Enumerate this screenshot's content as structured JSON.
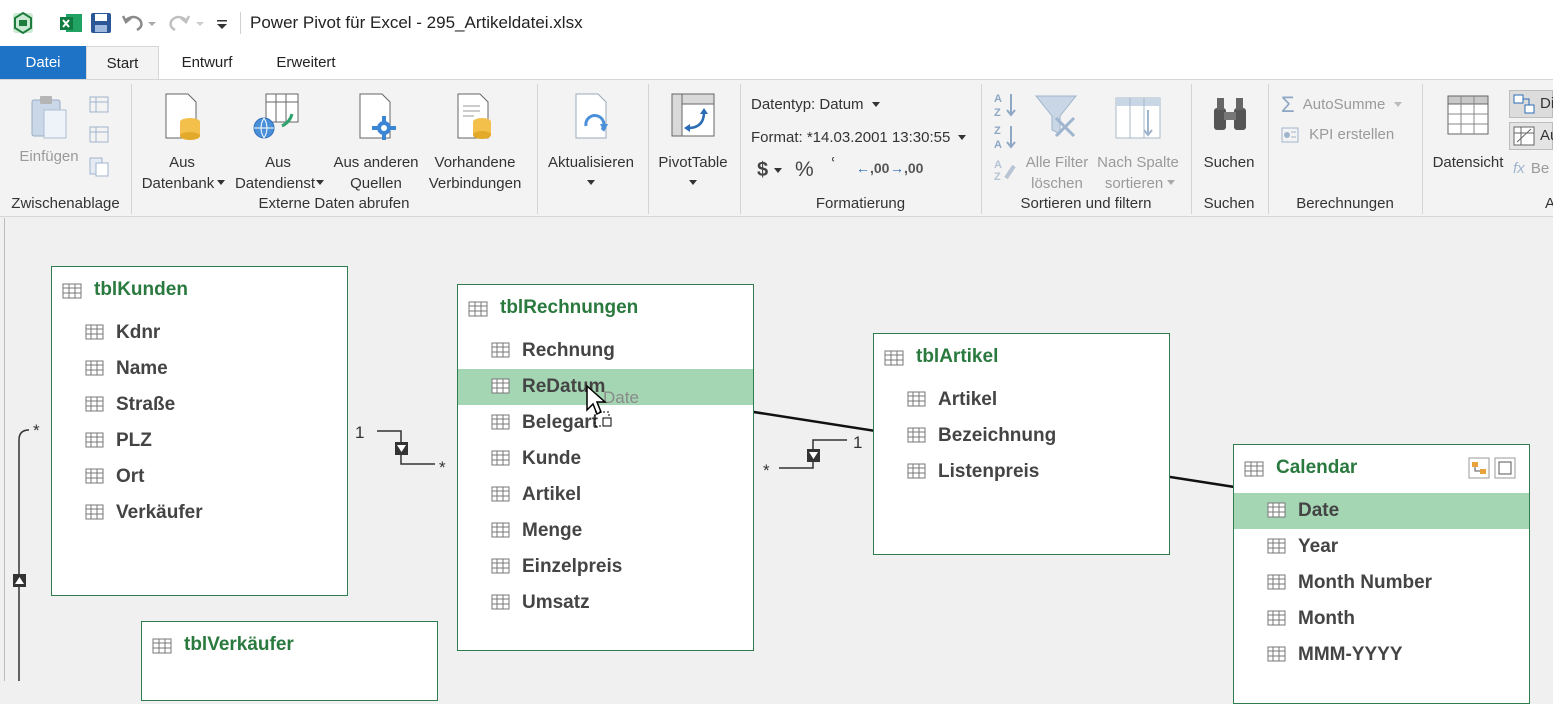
{
  "window": {
    "title": "Power Pivot für Excel - 295_Artikeldatei.xlsx"
  },
  "tabs": [
    {
      "label": "Datei"
    },
    {
      "label": "Start"
    },
    {
      "label": "Entwurf"
    },
    {
      "label": "Erweitert"
    }
  ],
  "ribbon": {
    "clipboard": {
      "paste_label": "Einfügen",
      "group_label": "Zwischenablage"
    },
    "external": {
      "from_db_line1": "Aus",
      "from_db_line2": "Datenbank",
      "from_service_line1": "Aus",
      "from_service_line2": "Datendienst",
      "other_sources_line1": "Aus anderen",
      "other_sources_line2": "Quellen",
      "existing_line1": "Vorhandene",
      "existing_line2": "Verbindungen",
      "group_label": "Externe Daten abrufen"
    },
    "refresh_label": "Aktualisieren",
    "pivot_label": "PivotTable",
    "formatting": {
      "datatype_label": "Datentyp: Datum",
      "format_label": "Format: *14.03.2001 13:30:55",
      "currency_symbol": "$",
      "percent_symbol": "%",
      "comma_symbol": "ʿ",
      "inc_decimal": ",00",
      "dec_decimal": ",00",
      "group_label": "Formatierung"
    },
    "sort_filter": {
      "clear_filter_line1": "Alle Filter",
      "clear_filter_line2": "löschen",
      "sort_col_line1": "Nach Spalte",
      "sort_col_line2": "sortieren",
      "group_label": "Sortieren und filtern"
    },
    "search": {
      "button_label": "Suchen",
      "group_label": "Suchen"
    },
    "calc": {
      "autosum_label": "AutoSumme",
      "kpi_label": "KPI erstellen",
      "group_label": "Berechnungen"
    },
    "view": {
      "data_view_label": "Datensicht",
      "diagram_short": "Di",
      "calc_area_short": "Au",
      "fx_short": "Be",
      "group_short": "A"
    }
  },
  "diagram": {
    "tables": [
      {
        "name": "tblKunden",
        "fields": [
          "Kdnr",
          "Name",
          "Straße",
          "PLZ",
          "Ort",
          "Verkäufer"
        ]
      },
      {
        "name": "tblRechnungen",
        "fields": [
          "Rechnung",
          "ReDatum",
          "Belegart",
          "Kunde",
          "Artikel",
          "Menge",
          "Einzelpreis",
          "Umsatz"
        ]
      },
      {
        "name": "tblArtikel",
        "fields": [
          "Artikel",
          "Bezeichnung",
          "Listenpreis"
        ]
      },
      {
        "name": "Calendar",
        "fields": [
          "Date",
          "Year",
          "Month Number",
          "Month",
          "MMM-YYYY"
        ]
      },
      {
        "name": "tblVerkäufer",
        "fields": []
      }
    ],
    "relationship_labels": {
      "one": "1",
      "many": "*"
    },
    "drag_ghost_text": "Date"
  }
}
